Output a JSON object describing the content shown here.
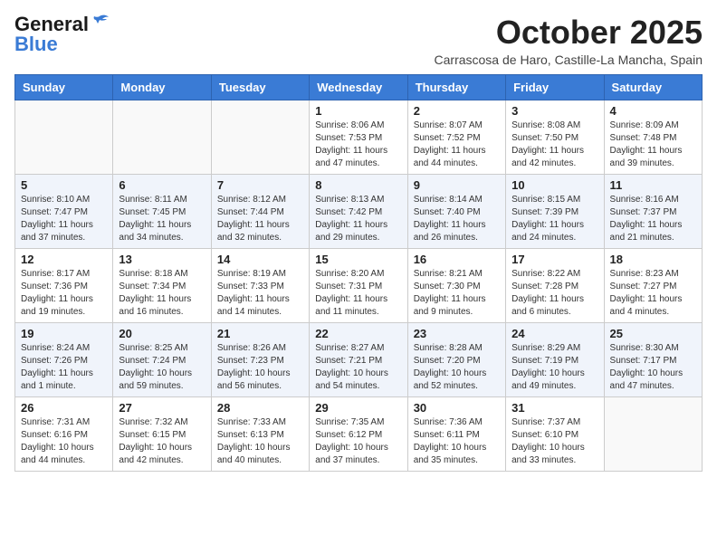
{
  "header": {
    "logo_general": "General",
    "logo_blue": "Blue",
    "month_title": "October 2025",
    "location": "Carrascosa de Haro, Castille-La Mancha, Spain"
  },
  "days_of_week": [
    "Sunday",
    "Monday",
    "Tuesday",
    "Wednesday",
    "Thursday",
    "Friday",
    "Saturday"
  ],
  "weeks": [
    [
      {
        "day": "",
        "info": ""
      },
      {
        "day": "",
        "info": ""
      },
      {
        "day": "",
        "info": ""
      },
      {
        "day": "1",
        "info": "Sunrise: 8:06 AM\nSunset: 7:53 PM\nDaylight: 11 hours and 47 minutes."
      },
      {
        "day": "2",
        "info": "Sunrise: 8:07 AM\nSunset: 7:52 PM\nDaylight: 11 hours and 44 minutes."
      },
      {
        "day": "3",
        "info": "Sunrise: 8:08 AM\nSunset: 7:50 PM\nDaylight: 11 hours and 42 minutes."
      },
      {
        "day": "4",
        "info": "Sunrise: 8:09 AM\nSunset: 7:48 PM\nDaylight: 11 hours and 39 minutes."
      }
    ],
    [
      {
        "day": "5",
        "info": "Sunrise: 8:10 AM\nSunset: 7:47 PM\nDaylight: 11 hours and 37 minutes."
      },
      {
        "day": "6",
        "info": "Sunrise: 8:11 AM\nSunset: 7:45 PM\nDaylight: 11 hours and 34 minutes."
      },
      {
        "day": "7",
        "info": "Sunrise: 8:12 AM\nSunset: 7:44 PM\nDaylight: 11 hours and 32 minutes."
      },
      {
        "day": "8",
        "info": "Sunrise: 8:13 AM\nSunset: 7:42 PM\nDaylight: 11 hours and 29 minutes."
      },
      {
        "day": "9",
        "info": "Sunrise: 8:14 AM\nSunset: 7:40 PM\nDaylight: 11 hours and 26 minutes."
      },
      {
        "day": "10",
        "info": "Sunrise: 8:15 AM\nSunset: 7:39 PM\nDaylight: 11 hours and 24 minutes."
      },
      {
        "day": "11",
        "info": "Sunrise: 8:16 AM\nSunset: 7:37 PM\nDaylight: 11 hours and 21 minutes."
      }
    ],
    [
      {
        "day": "12",
        "info": "Sunrise: 8:17 AM\nSunset: 7:36 PM\nDaylight: 11 hours and 19 minutes."
      },
      {
        "day": "13",
        "info": "Sunrise: 8:18 AM\nSunset: 7:34 PM\nDaylight: 11 hours and 16 minutes."
      },
      {
        "day": "14",
        "info": "Sunrise: 8:19 AM\nSunset: 7:33 PM\nDaylight: 11 hours and 14 minutes."
      },
      {
        "day": "15",
        "info": "Sunrise: 8:20 AM\nSunset: 7:31 PM\nDaylight: 11 hours and 11 minutes."
      },
      {
        "day": "16",
        "info": "Sunrise: 8:21 AM\nSunset: 7:30 PM\nDaylight: 11 hours and 9 minutes."
      },
      {
        "day": "17",
        "info": "Sunrise: 8:22 AM\nSunset: 7:28 PM\nDaylight: 11 hours and 6 minutes."
      },
      {
        "day": "18",
        "info": "Sunrise: 8:23 AM\nSunset: 7:27 PM\nDaylight: 11 hours and 4 minutes."
      }
    ],
    [
      {
        "day": "19",
        "info": "Sunrise: 8:24 AM\nSunset: 7:26 PM\nDaylight: 11 hours and 1 minute."
      },
      {
        "day": "20",
        "info": "Sunrise: 8:25 AM\nSunset: 7:24 PM\nDaylight: 10 hours and 59 minutes."
      },
      {
        "day": "21",
        "info": "Sunrise: 8:26 AM\nSunset: 7:23 PM\nDaylight: 10 hours and 56 minutes."
      },
      {
        "day": "22",
        "info": "Sunrise: 8:27 AM\nSunset: 7:21 PM\nDaylight: 10 hours and 54 minutes."
      },
      {
        "day": "23",
        "info": "Sunrise: 8:28 AM\nSunset: 7:20 PM\nDaylight: 10 hours and 52 minutes."
      },
      {
        "day": "24",
        "info": "Sunrise: 8:29 AM\nSunset: 7:19 PM\nDaylight: 10 hours and 49 minutes."
      },
      {
        "day": "25",
        "info": "Sunrise: 8:30 AM\nSunset: 7:17 PM\nDaylight: 10 hours and 47 minutes."
      }
    ],
    [
      {
        "day": "26",
        "info": "Sunrise: 7:31 AM\nSunset: 6:16 PM\nDaylight: 10 hours and 44 minutes."
      },
      {
        "day": "27",
        "info": "Sunrise: 7:32 AM\nSunset: 6:15 PM\nDaylight: 10 hours and 42 minutes."
      },
      {
        "day": "28",
        "info": "Sunrise: 7:33 AM\nSunset: 6:13 PM\nDaylight: 10 hours and 40 minutes."
      },
      {
        "day": "29",
        "info": "Sunrise: 7:35 AM\nSunset: 6:12 PM\nDaylight: 10 hours and 37 minutes."
      },
      {
        "day": "30",
        "info": "Sunrise: 7:36 AM\nSunset: 6:11 PM\nDaylight: 10 hours and 35 minutes."
      },
      {
        "day": "31",
        "info": "Sunrise: 7:37 AM\nSunset: 6:10 PM\nDaylight: 10 hours and 33 minutes."
      },
      {
        "day": "",
        "info": ""
      }
    ]
  ]
}
